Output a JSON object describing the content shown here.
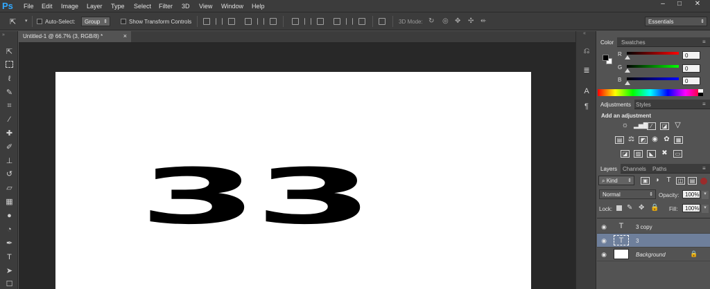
{
  "app": {
    "logo": "Ps"
  },
  "menu": [
    "File",
    "Edit",
    "Image",
    "Layer",
    "Type",
    "Select",
    "Filter",
    "3D",
    "View",
    "Window",
    "Help"
  ],
  "window_controls": {
    "minimize": "–",
    "maximize": "□",
    "close": "✕"
  },
  "options": {
    "auto_select_label": "Auto-Select:",
    "auto_select_value": "Group",
    "show_transform": "Show Transform Controls",
    "mode_3d": "3D Mode:",
    "workspace": "Essentials"
  },
  "document": {
    "tab_title": "Untitled-1 @ 66.7% (3, RGB/8) *",
    "tab_close": "×",
    "text_layers": [
      "3",
      "3"
    ]
  },
  "color_panel": {
    "tabs": [
      "Color",
      "Swatches"
    ],
    "channels": [
      {
        "label": "R",
        "value": "0",
        "gradient_to": "#ff0000"
      },
      {
        "label": "G",
        "value": "0",
        "gradient_to": "#00ff00"
      },
      {
        "label": "B",
        "value": "0",
        "gradient_to": "#0000ff"
      }
    ]
  },
  "adjustments_panel": {
    "tabs": [
      "Adjustments",
      "Styles"
    ],
    "heading": "Add an adjustment"
  },
  "layers_panel": {
    "tabs": [
      "Layers",
      "Channels",
      "Paths"
    ],
    "kind": "Kind",
    "blend_mode": "Normal",
    "opacity_label": "Opacity:",
    "opacity_value": "100%",
    "lock_label": "Lock:",
    "fill_label": "Fill:",
    "fill_value": "100%",
    "layers": [
      {
        "name": "3 copy",
        "type": "T",
        "selected": false
      },
      {
        "name": "3",
        "type": "T",
        "selected": true
      },
      {
        "name": "Background",
        "type": "",
        "selected": false
      }
    ]
  },
  "colors": {
    "selected_layer": "#6e7f9b",
    "brand": "#31a8ff"
  }
}
